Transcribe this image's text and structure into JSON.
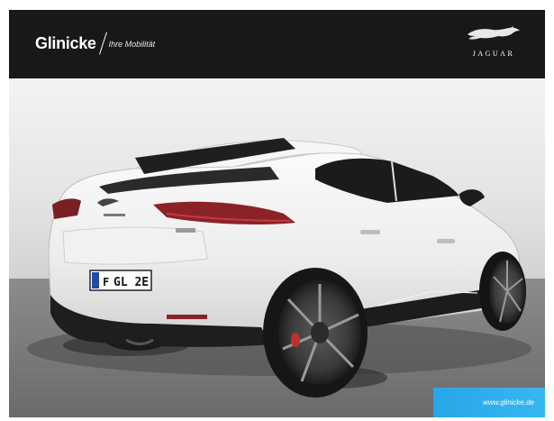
{
  "banner": {
    "dealer_name": "Glinicke",
    "tagline": "Ihre Mobilität",
    "brand_name": "JAGUAR",
    "brand_icon": "leaping-jaguar-icon",
    "background": "#181818"
  },
  "photo": {
    "plate": "GL 2E",
    "plate_prefix": "F",
    "vehicle_color": "#f2f2f2"
  },
  "footer": {
    "link_text": "www.glinicke.de",
    "link_color": "#2aaeee"
  }
}
